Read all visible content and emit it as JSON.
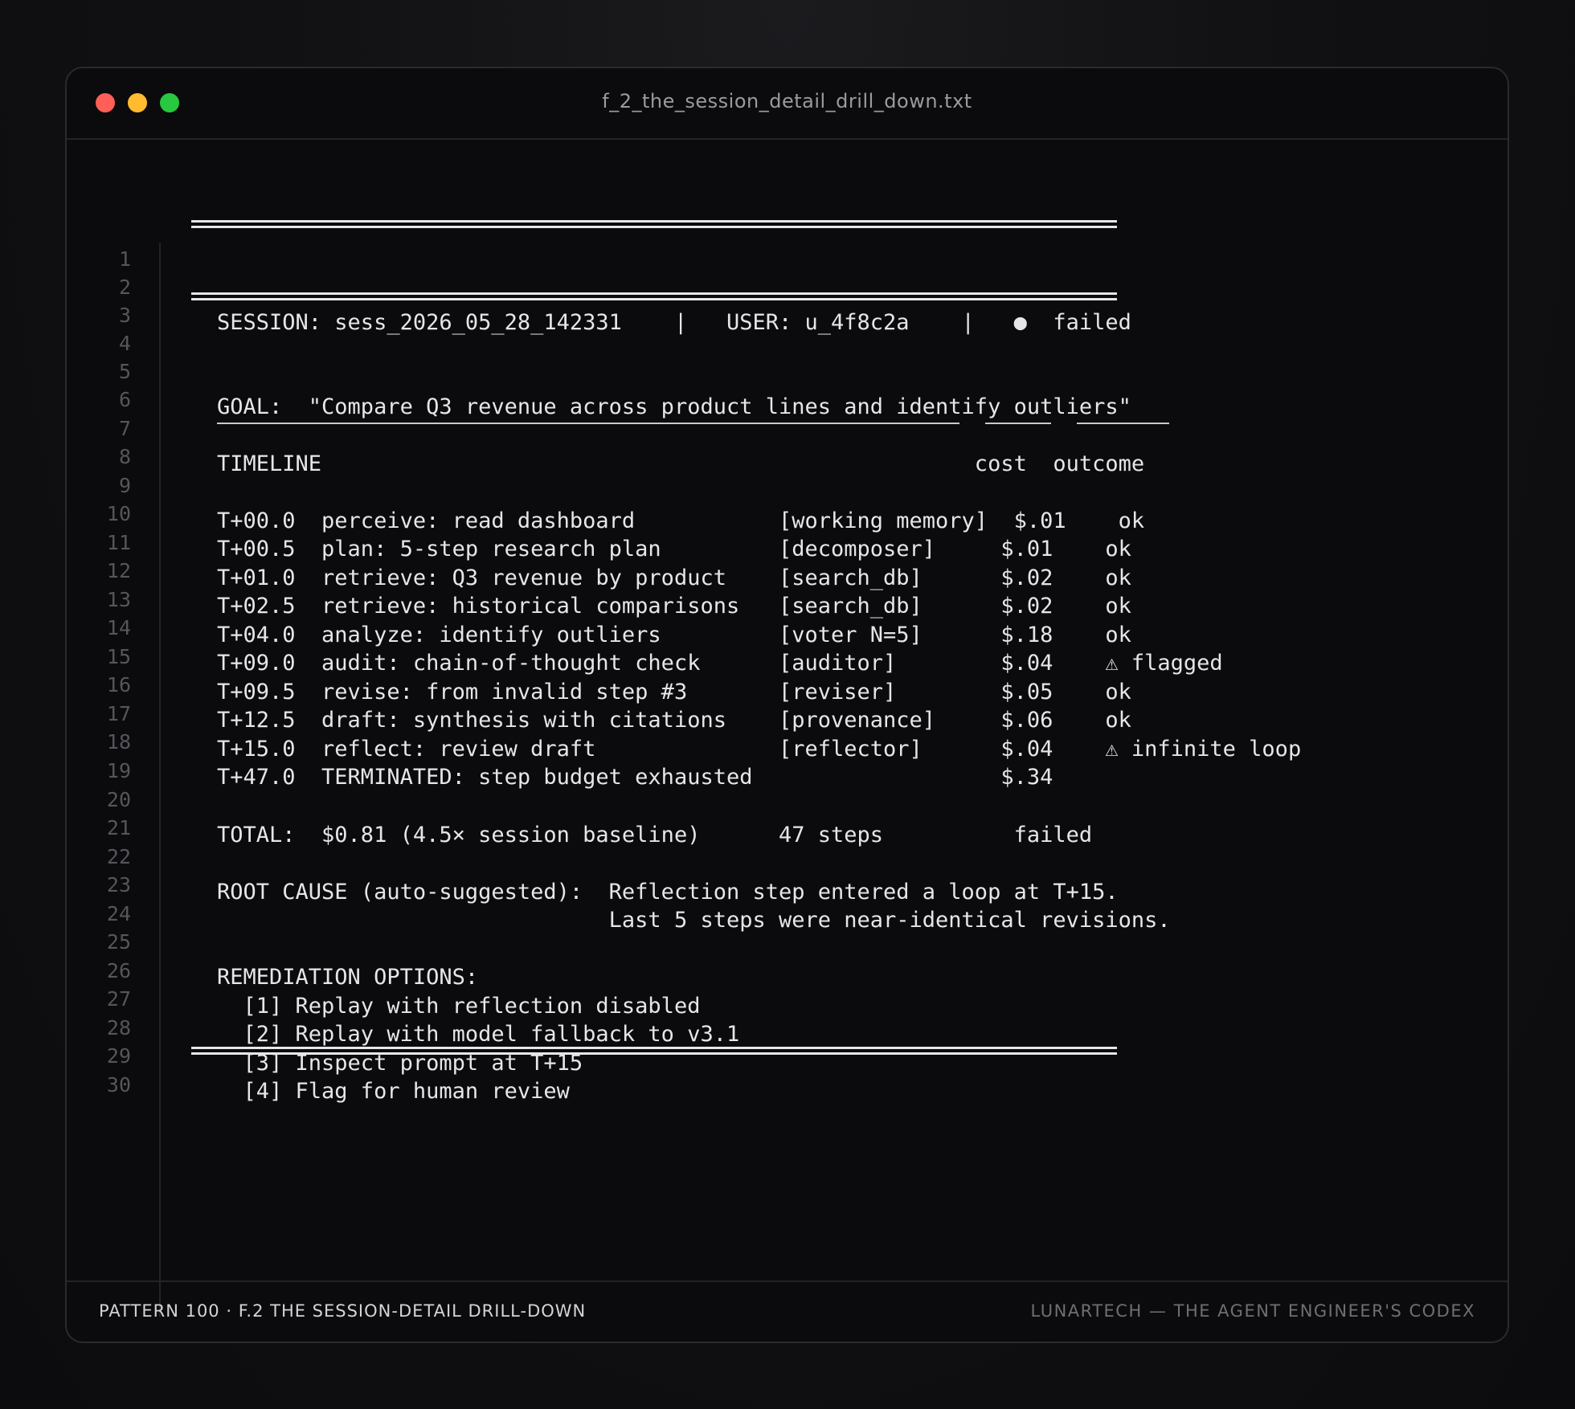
{
  "window": {
    "title": "f_2_the_session_detail_drill_down.txt"
  },
  "lines": [
    {
      "n": "1",
      "text": ""
    },
    {
      "n": "2",
      "text": "SESSION: sess_2026_05_28_142331    |   USER: u_4f8c2a    |   ●  failed"
    },
    {
      "n": "3",
      "text": ""
    },
    {
      "n": "4",
      "text": ""
    },
    {
      "n": "5",
      "text": "GOAL:  \"Compare Q3 revenue across product lines and identify outliers\""
    },
    {
      "n": "6",
      "text": ""
    },
    {
      "n": "7",
      "text": "TIMELINE                                                  cost  outcome"
    },
    {
      "n": "8",
      "text": ""
    },
    {
      "n": "9",
      "text": "T+00.0  perceive: read dashboard           [working memory]  $.01    ok"
    },
    {
      "n": "10",
      "text": "T+00.5  plan: 5-step research plan         [decomposer]     $.01    ok"
    },
    {
      "n": "11",
      "text": "T+01.0  retrieve: Q3 revenue by product    [search_db]      $.02    ok"
    },
    {
      "n": "12",
      "text": "T+02.5  retrieve: historical comparisons   [search_db]      $.02    ok"
    },
    {
      "n": "13",
      "text": "T+04.0  analyze: identify outliers         [voter N=5]      $.18    ok"
    },
    {
      "n": "14",
      "text": "T+09.0  audit: chain-of-thought check      [auditor]        $.04    ⚠ flagged"
    },
    {
      "n": "15",
      "text": "T+09.5  revise: from invalid step #3       [reviser]        $.05    ok"
    },
    {
      "n": "16",
      "text": "T+12.5  draft: synthesis with citations    [provenance]     $.06    ok"
    },
    {
      "n": "17",
      "text": "T+15.0  reflect: review draft              [reflector]      $.04    ⚠ infinite loop"
    },
    {
      "n": "18",
      "text": "T+47.0  TERMINATED: step budget exhausted                   $.34"
    },
    {
      "n": "19",
      "text": ""
    },
    {
      "n": "20",
      "text": "TOTAL:  $0.81 (4.5× session baseline)      47 steps          failed"
    },
    {
      "n": "21",
      "text": ""
    },
    {
      "n": "22",
      "text": "ROOT CAUSE (auto-suggested):  Reflection step entered a loop at T+15."
    },
    {
      "n": "23",
      "text": "                              Last 5 steps were near-identical revisions."
    },
    {
      "n": "24",
      "text": ""
    },
    {
      "n": "25",
      "text": "REMEDIATION OPTIONS:"
    },
    {
      "n": "26",
      "text": "  [1] Replay with reflection disabled"
    },
    {
      "n": "27",
      "text": "  [2] Replay with model fallback to v3.1"
    },
    {
      "n": "28",
      "text": "  [3] Inspect prompt at T+15"
    },
    {
      "n": "29",
      "text": "  [4] Flag for human review"
    },
    {
      "n": "30",
      "text": ""
    }
  ],
  "footer": {
    "left": "PATTERN 100 · F.2 THE SESSION-DETAIL DRILL-DOWN",
    "right": "LUNARTECH — THE AGENT ENGINEER'S CODEX"
  },
  "colors": {
    "close": "#fe5f57",
    "minimize": "#febc2e",
    "maximize": "#28c840",
    "text": "#e6e6ea",
    "line_numbers": "#55555b"
  }
}
